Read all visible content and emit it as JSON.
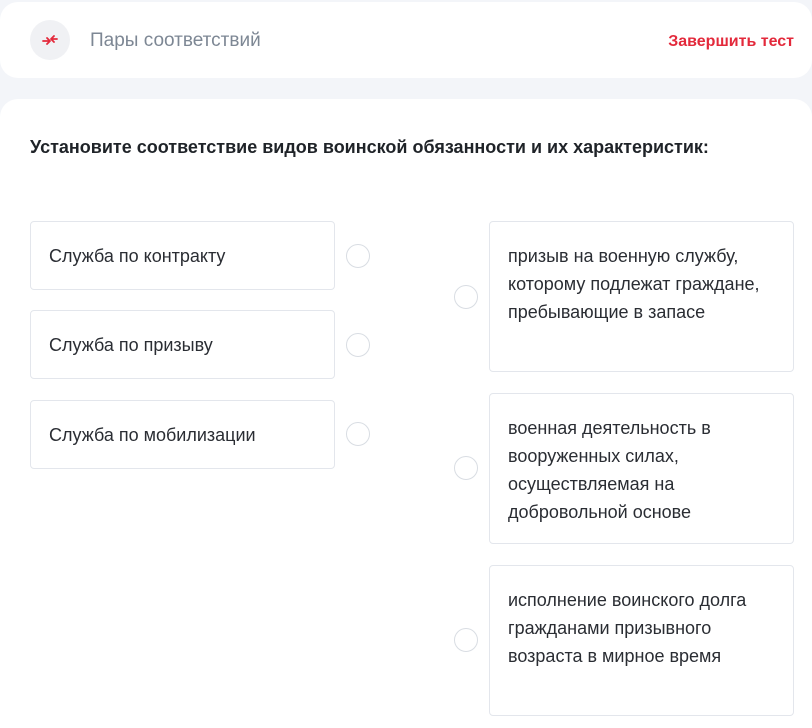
{
  "header": {
    "title": "Пары соответствий",
    "icon": "swap-arrows-icon",
    "finish_label": "Завершить тест",
    "accent_color": "#e3293b"
  },
  "question": {
    "text": "Установите соответствие видов воинской обязанности и их характеристик:"
  },
  "left_items": [
    {
      "label": "Служба по контракту"
    },
    {
      "label": "Служба по призыву"
    },
    {
      "label": "Служба по мобилизации"
    }
  ],
  "right_items": [
    {
      "label": "призыв на военную службу, которому подлежат граждане, пребывающие в запасе"
    },
    {
      "label": "военная деятельность в вооруженных силах, осуществляемая на добровольной основе"
    },
    {
      "label": "исполнение воинского долга гражданами призывного возраста в мирное время"
    }
  ]
}
